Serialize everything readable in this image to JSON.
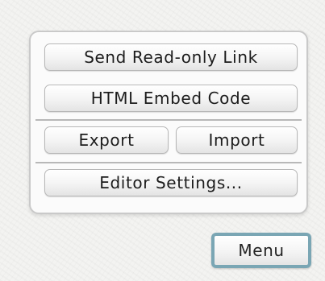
{
  "menu": {
    "items": {
      "send_read_only_link": "Send Read-only Link",
      "html_embed_code": "HTML Embed Code",
      "export": "Export",
      "import": "Import",
      "editor_settings": "Editor Settings..."
    }
  },
  "toggle": {
    "label": "Menu"
  },
  "colors": {
    "toggle_border": "#7aa6b4",
    "panel_border": "#c9c9c9",
    "button_text": "#1c1c1c"
  }
}
